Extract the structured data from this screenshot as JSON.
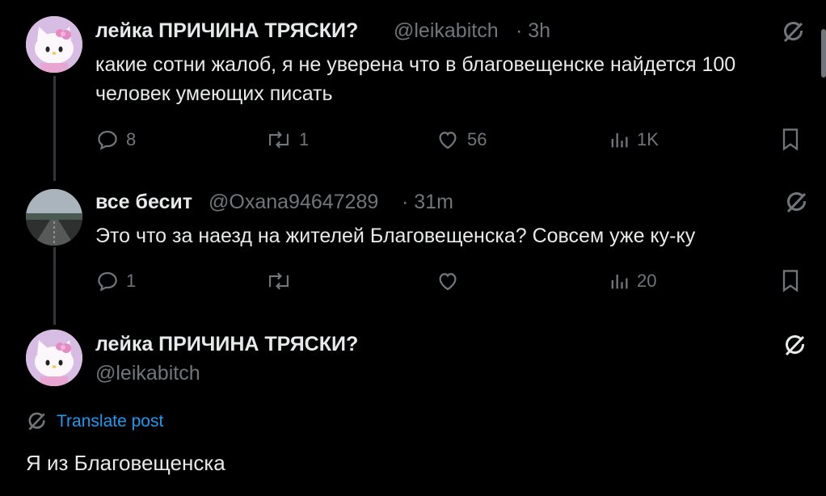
{
  "tweets": [
    {
      "display_name": "лейка ПРИЧИНА ТРЯСКИ?",
      "handle": "@leikabitch",
      "time": "· 3h",
      "text": "какие сотни жалоб, я не уверена что в благовещенске найдется 100 человек умеющих писать",
      "replies": "8",
      "retweets": "1",
      "likes": "56",
      "views": "1K"
    },
    {
      "display_name": "все бесит",
      "handle": "@Oxana94647289",
      "time": "· 31m",
      "text": "Это что за наезд на жителей Благовещенска? Совсем уже ку-ку",
      "replies": "1",
      "retweets": "",
      "likes": "",
      "views": "20"
    }
  ],
  "main_tweet": {
    "display_name": "лейка ПРИЧИНА ТРЯСКИ?",
    "handle": "@leikabitch",
    "translate_label": "Translate post",
    "text": "Я из Благовещенска"
  },
  "colors": {
    "background": "#000000",
    "text": "#e7e9ea",
    "muted": "#71767b",
    "link": "#1d9bf0"
  }
}
